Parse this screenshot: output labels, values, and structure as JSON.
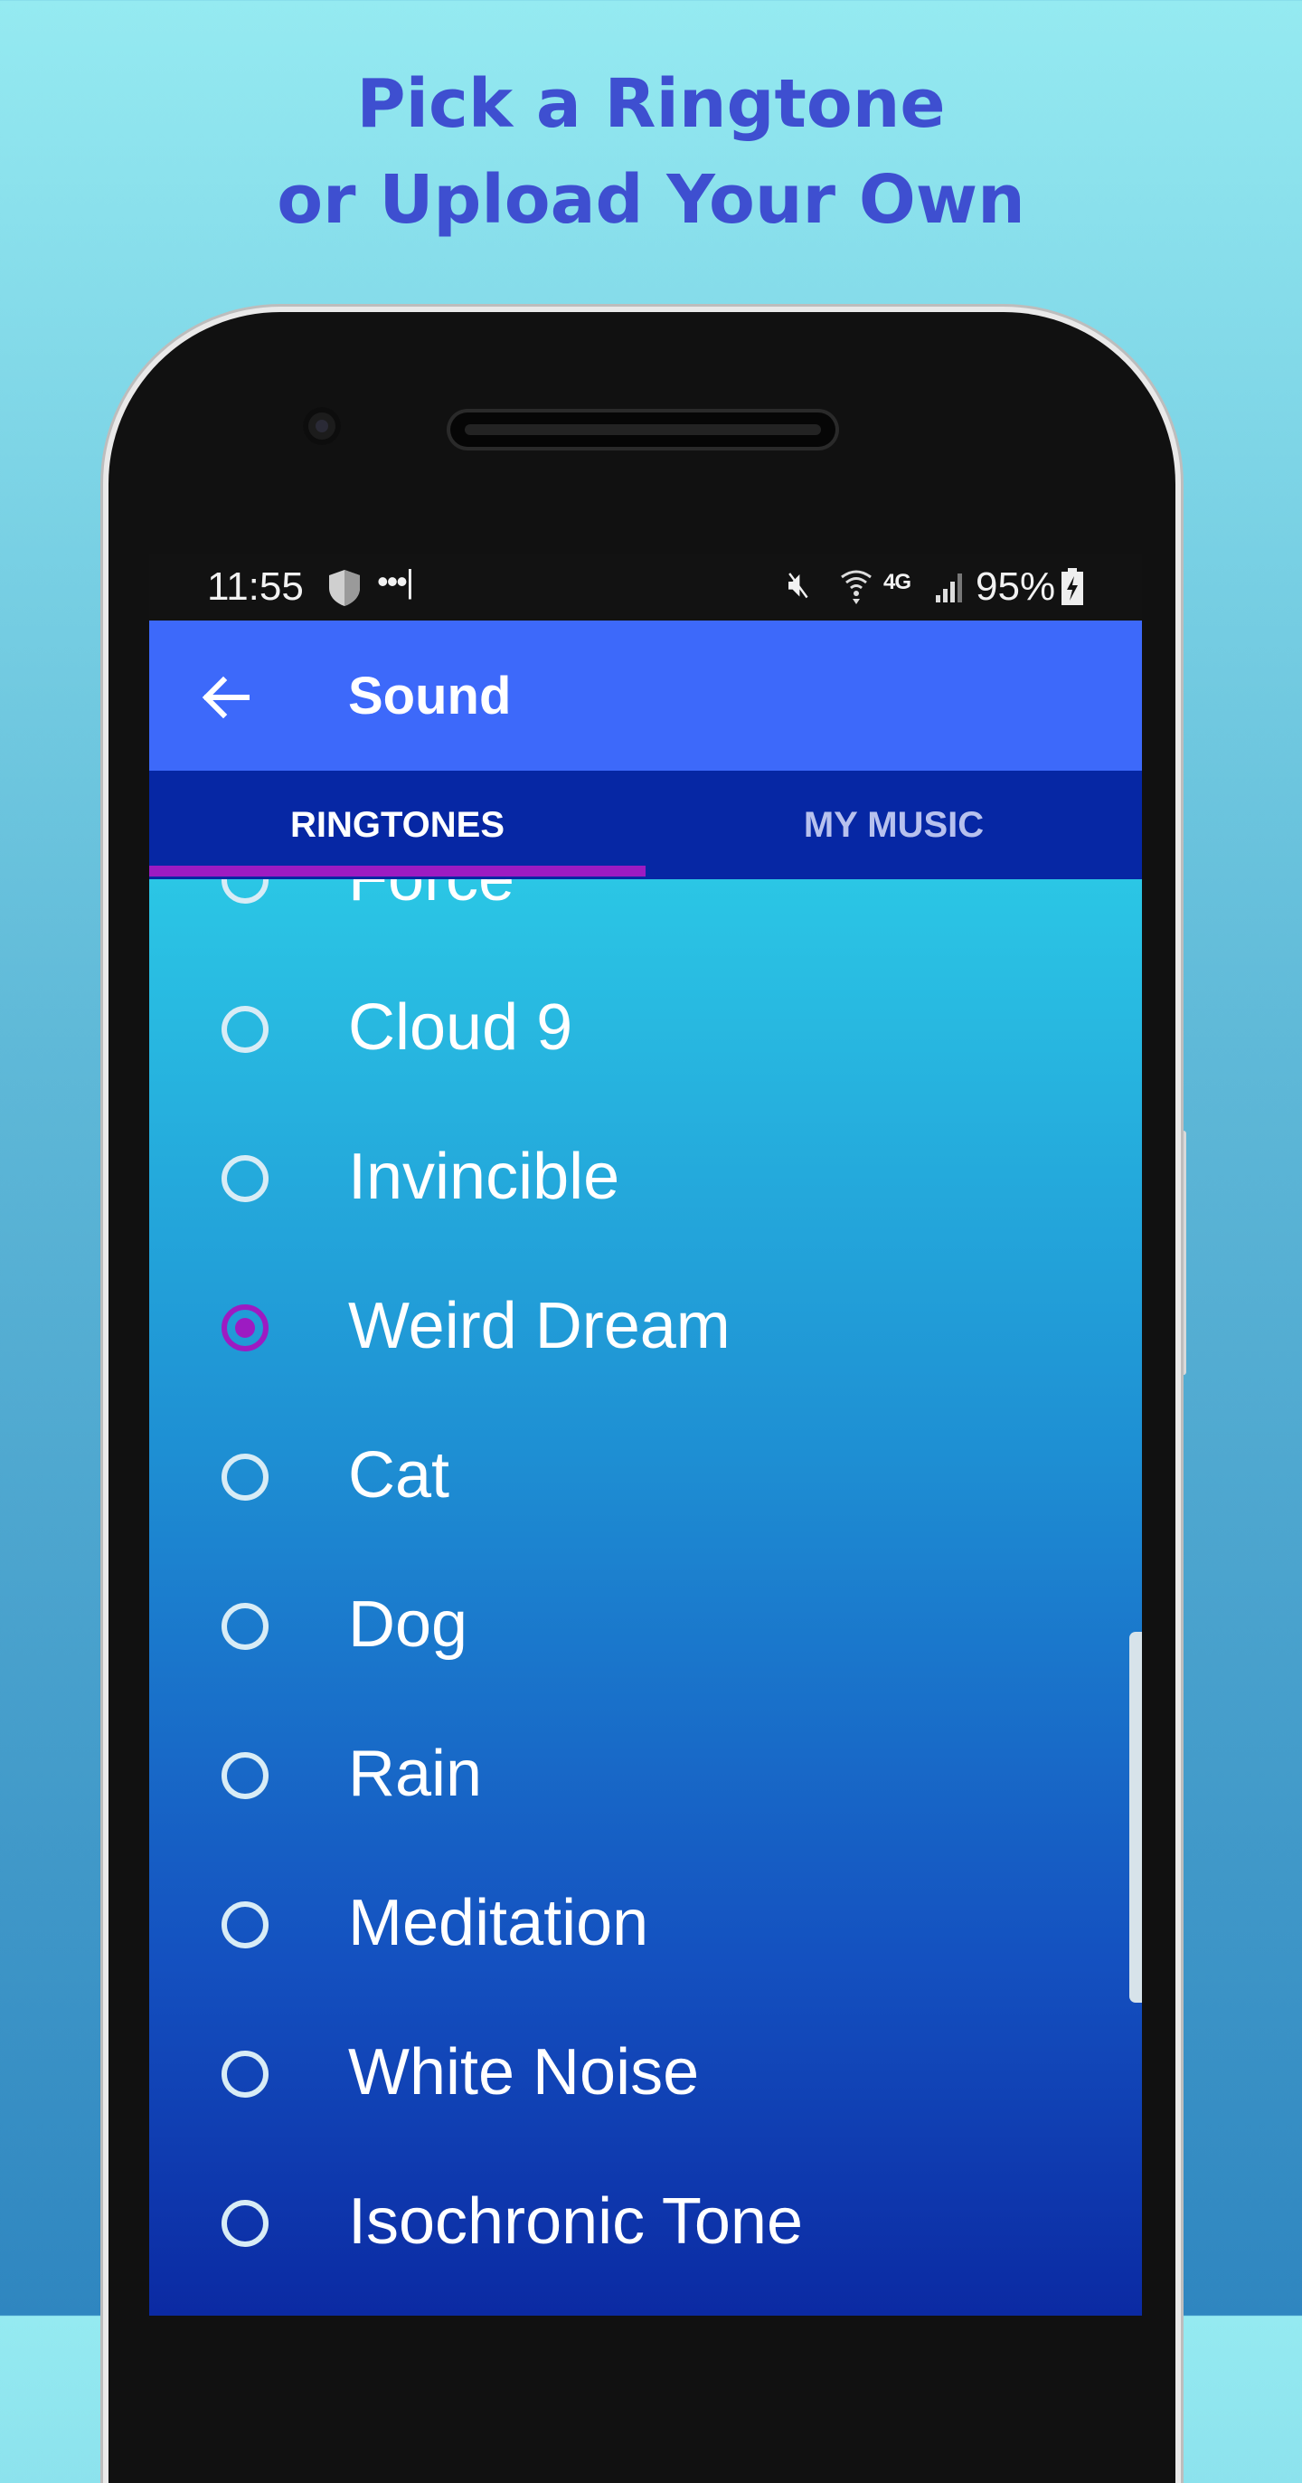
{
  "headline": {
    "line1": "Pick a Ringtone",
    "line2": "or Upload Your Own"
  },
  "status_bar": {
    "time": "11:55",
    "dots": "•••|",
    "network": "4G",
    "battery_percent": "95%"
  },
  "app_bar": {
    "title": "Sound",
    "back_icon": "arrow-left-icon"
  },
  "tabs": [
    {
      "label": "RINGTONES",
      "selected": true
    },
    {
      "label": "MY MUSIC",
      "selected": false
    }
  ],
  "ringtones": [
    {
      "label": "Force",
      "selected": false
    },
    {
      "label": "Cloud 9",
      "selected": false
    },
    {
      "label": "Invincible",
      "selected": false
    },
    {
      "label": "Weird Dream",
      "selected": true
    },
    {
      "label": "Cat",
      "selected": false
    },
    {
      "label": "Dog",
      "selected": false
    },
    {
      "label": "Rain",
      "selected": false
    },
    {
      "label": "Meditation",
      "selected": false
    },
    {
      "label": "White Noise",
      "selected": false
    },
    {
      "label": "Isochronic Tone",
      "selected": false
    }
  ],
  "colors": {
    "headline": "#3e4fd0",
    "app_bar": "#3d69fa",
    "tab_bar": "#0627a4",
    "accent": "#9d1bc2"
  }
}
